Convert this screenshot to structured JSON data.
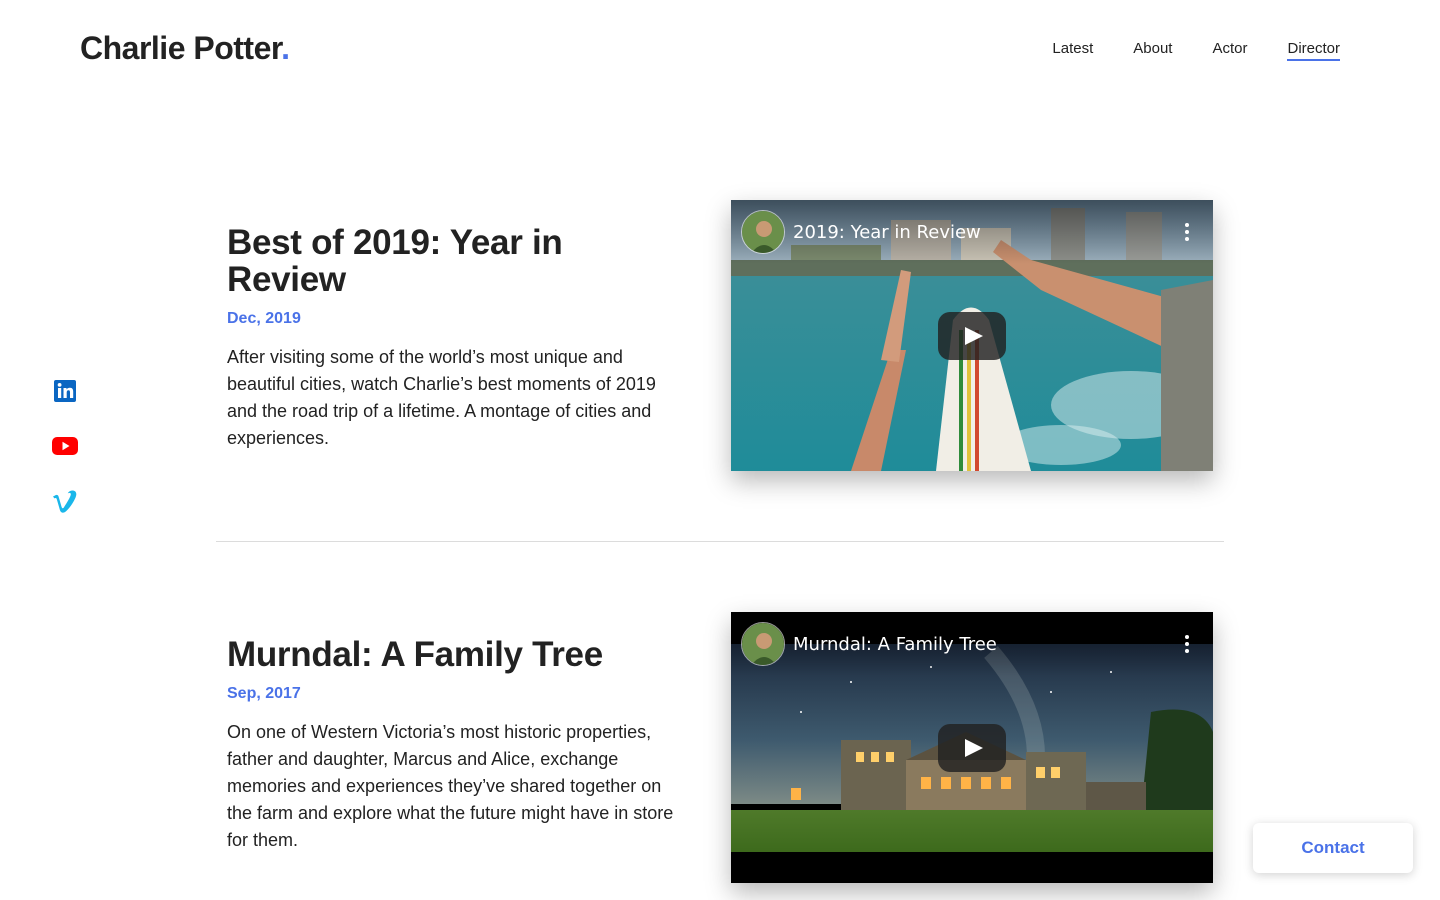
{
  "brand": {
    "name": "Charlie Potter",
    "dot": "."
  },
  "nav": {
    "items": [
      {
        "label": "Latest"
      },
      {
        "label": "About"
      },
      {
        "label": "Actor"
      },
      {
        "label": "Director",
        "active": true
      }
    ]
  },
  "social": {
    "items": [
      {
        "icon": "linkedin-icon",
        "color": "#0a66c2"
      },
      {
        "icon": "youtube-icon",
        "color": "#ff0000"
      },
      {
        "icon": "vimeo-icon",
        "color": "#1ab7ea"
      }
    ]
  },
  "posts": [
    {
      "title": "Best of 2019: Year in Review",
      "date": "Dec, 2019",
      "description": "After visiting some of the world’s most unique and beautiful cities, watch Charlie’s best moments of 2019 and the road trip of a lifetime. A montage of cities and experiences.",
      "video_title": "2019: Year in Review"
    },
    {
      "title": "Murndal: A Family Tree",
      "date": "Sep, 2017",
      "description": "On one of Western Victoria’s most historic properties, father and daughter, Marcus and Alice, exchange memories and experiences they’ve shared together on the farm and explore what the future might have in store for them.",
      "video_title": "Murndal: A Family Tree"
    }
  ],
  "contact": {
    "label": "Contact"
  },
  "colors": {
    "accent": "#4a72e8",
    "text": "#222222",
    "divider": "#dcdcdc"
  }
}
